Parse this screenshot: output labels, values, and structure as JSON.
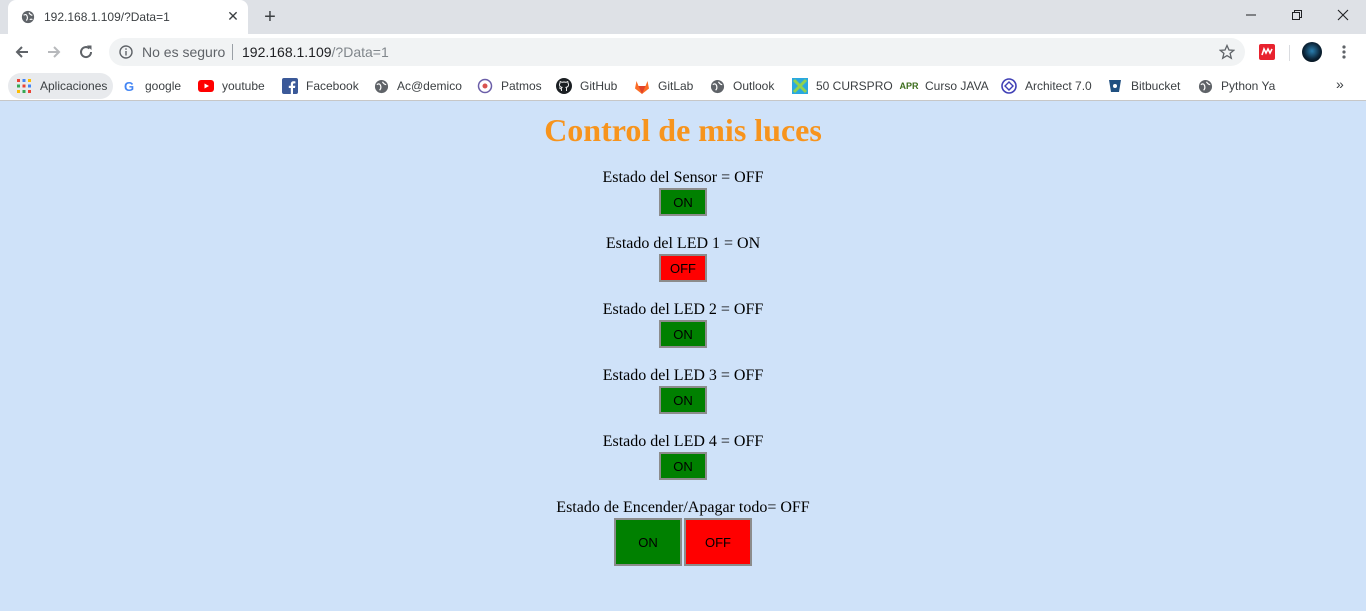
{
  "tab": {
    "title": "192.168.1.109/?Data=1",
    "close": "✕",
    "new_tab": "+"
  },
  "omnibox": {
    "security_text": "No es seguro",
    "url_host": "192.168.1.109",
    "url_query": "/?Data=1"
  },
  "bookmarks": [
    {
      "label": "Aplicaciones",
      "icon": "apps-grid-icon"
    },
    {
      "label": "google",
      "icon": "google-icon"
    },
    {
      "label": "youtube",
      "icon": "youtube-icon"
    },
    {
      "label": "Facebook",
      "icon": "facebook-icon"
    },
    {
      "label": "Ac@demico",
      "icon": "globe-icon"
    },
    {
      "label": "Patmos",
      "icon": "patmos-icon"
    },
    {
      "label": "GitHub",
      "icon": "github-icon"
    },
    {
      "label": "GitLab",
      "icon": "gitlab-icon"
    },
    {
      "label": "Outlook",
      "icon": "globe-icon"
    },
    {
      "label": "50 CURSPRO",
      "icon": "cursos-icon"
    },
    {
      "label": "Curso JAVA",
      "icon": "apr-icon"
    },
    {
      "label": "Architect 7.0",
      "icon": "architect-icon"
    },
    {
      "label": "Bitbucket",
      "icon": "bitbucket-icon"
    },
    {
      "label": "Python Ya",
      "icon": "globe-icon"
    }
  ],
  "bookmarks_more": "»",
  "page": {
    "title": "Control de mis luces",
    "controls": [
      {
        "label": "Estado del Sensor = OFF",
        "button": "ON"
      },
      {
        "label": "Estado del LED 1 = ON",
        "button": "OFF"
      },
      {
        "label": "Estado del LED 2 = OFF",
        "button": "ON"
      },
      {
        "label": "Estado del LED 3 = OFF",
        "button": "ON"
      },
      {
        "label": "Estado del LED 4 = OFF",
        "button": "ON"
      }
    ],
    "all": {
      "label": "Estado de Encender/Apagar todo= OFF",
      "on_button": "ON",
      "off_button": "OFF"
    }
  },
  "colors": {
    "page_background": "#cfe2f9",
    "title": "#f7941d",
    "on_button": "#008000",
    "off_button": "#ff0000"
  }
}
